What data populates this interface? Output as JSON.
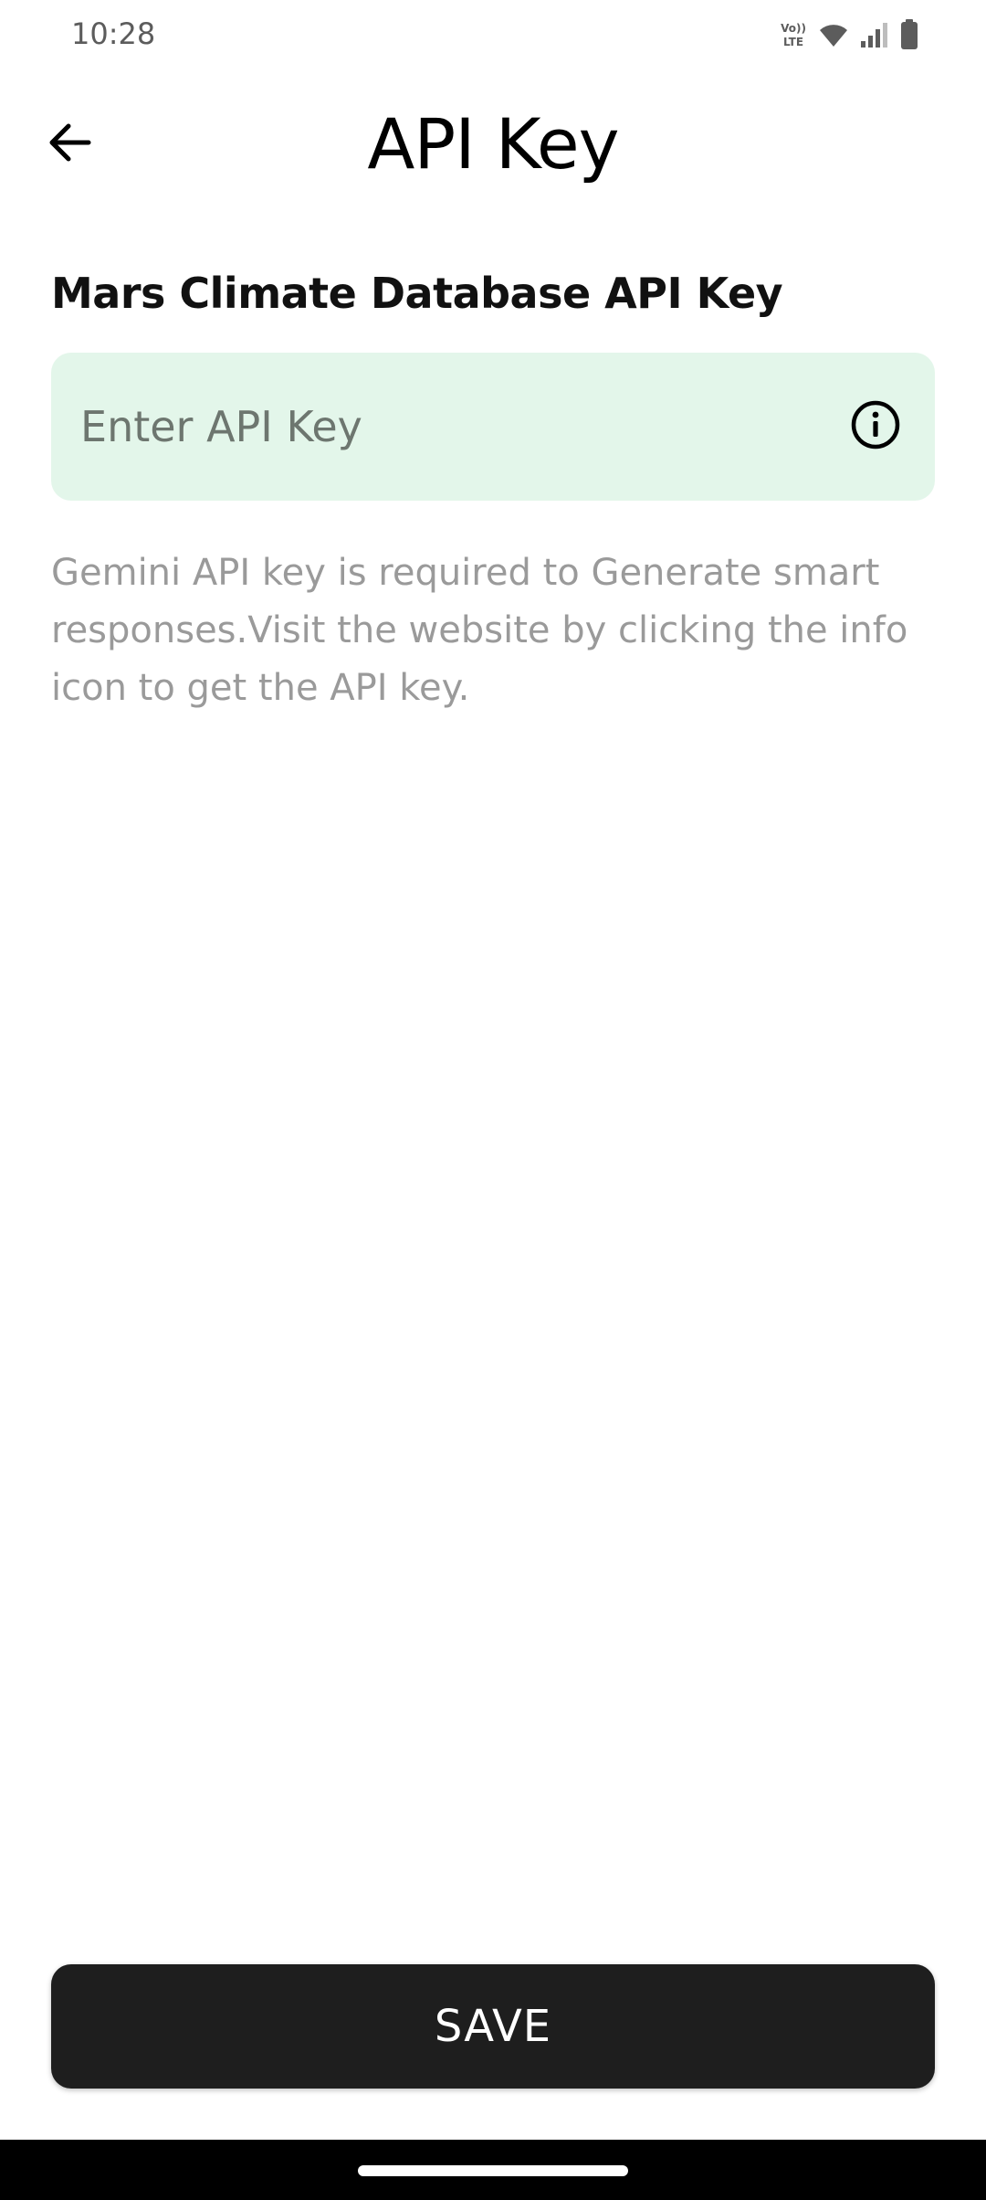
{
  "status_bar": {
    "time": "10:28",
    "icons": [
      "volte-icon",
      "wifi-icon",
      "signal-icon",
      "battery-icon"
    ],
    "volte_top": "Vo))",
    "volte_bottom": "LTE"
  },
  "app_bar": {
    "title": "API Key",
    "back_icon": "arrow-left-icon"
  },
  "form": {
    "label": "Mars Climate Database API Key",
    "input": {
      "value": "",
      "placeholder": "Enter API Key"
    },
    "info_icon": "info-circle-icon",
    "helper_text": "Gemini API key is required to Generate smart responses.Visit the website by clicking the info icon to get the API key."
  },
  "actions": {
    "save_label": "SAVE"
  },
  "colors": {
    "input_background": "#e3f6ea",
    "button_background": "#1e1e1e",
    "helper_text": "#9a9a9a",
    "nav_bar": "#000000"
  }
}
